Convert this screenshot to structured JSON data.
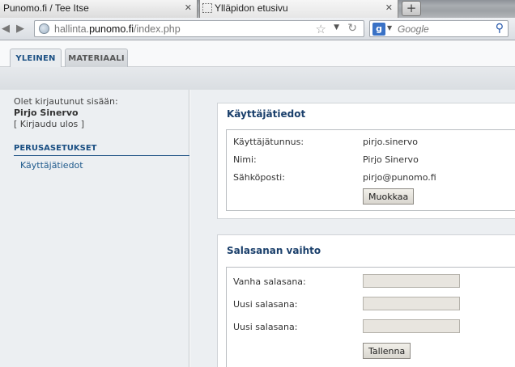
{
  "browser": {
    "tabs": [
      {
        "title": "Punomo.fi / Tee Itse"
      },
      {
        "title": "Ylläpidon etusivu"
      }
    ],
    "new_tab_label": "+",
    "url_prefix": "hallinta.",
    "url_domain": "punomo.fi",
    "url_suffix": "/index.php",
    "search_placeholder": "Google",
    "search_engine_letter": "g"
  },
  "page_tabs": [
    {
      "label": "YLEINEN",
      "active": true
    },
    {
      "label": "MATERIAALI",
      "active": false
    }
  ],
  "sidebar": {
    "logged_in_text": "Olet kirjautunut sisään:",
    "user_name": "Pirjo Sinervo",
    "logout_text": "[ Kirjaudu ulos ]",
    "section_title": "PERUSASETUKSET",
    "nav_item": "Käyttäjätiedot"
  },
  "user_info": {
    "title": "Käyttäjätiedot",
    "rows": [
      {
        "label": "Käyttäjätunnus:",
        "value": "pirjo.sinervo"
      },
      {
        "label": "Nimi:",
        "value": "Pirjo Sinervo"
      },
      {
        "label": "Sähköposti:",
        "value": "pirjo@punomo.fi"
      }
    ],
    "edit_button": "Muokkaa"
  },
  "password_change": {
    "title": "Salasanan vaihto",
    "fields": [
      {
        "label": "Vanha salasana:",
        "value": ""
      },
      {
        "label": "Uusi salasana:",
        "value": ""
      },
      {
        "label": "Uusi salasana:",
        "value": ""
      }
    ],
    "save_button": "Tallenna"
  },
  "colors": {
    "accent": "#1a4f83",
    "title": "#1a3f6b",
    "panel_bg": "#eceff2",
    "input_bg": "#e8e5df"
  }
}
